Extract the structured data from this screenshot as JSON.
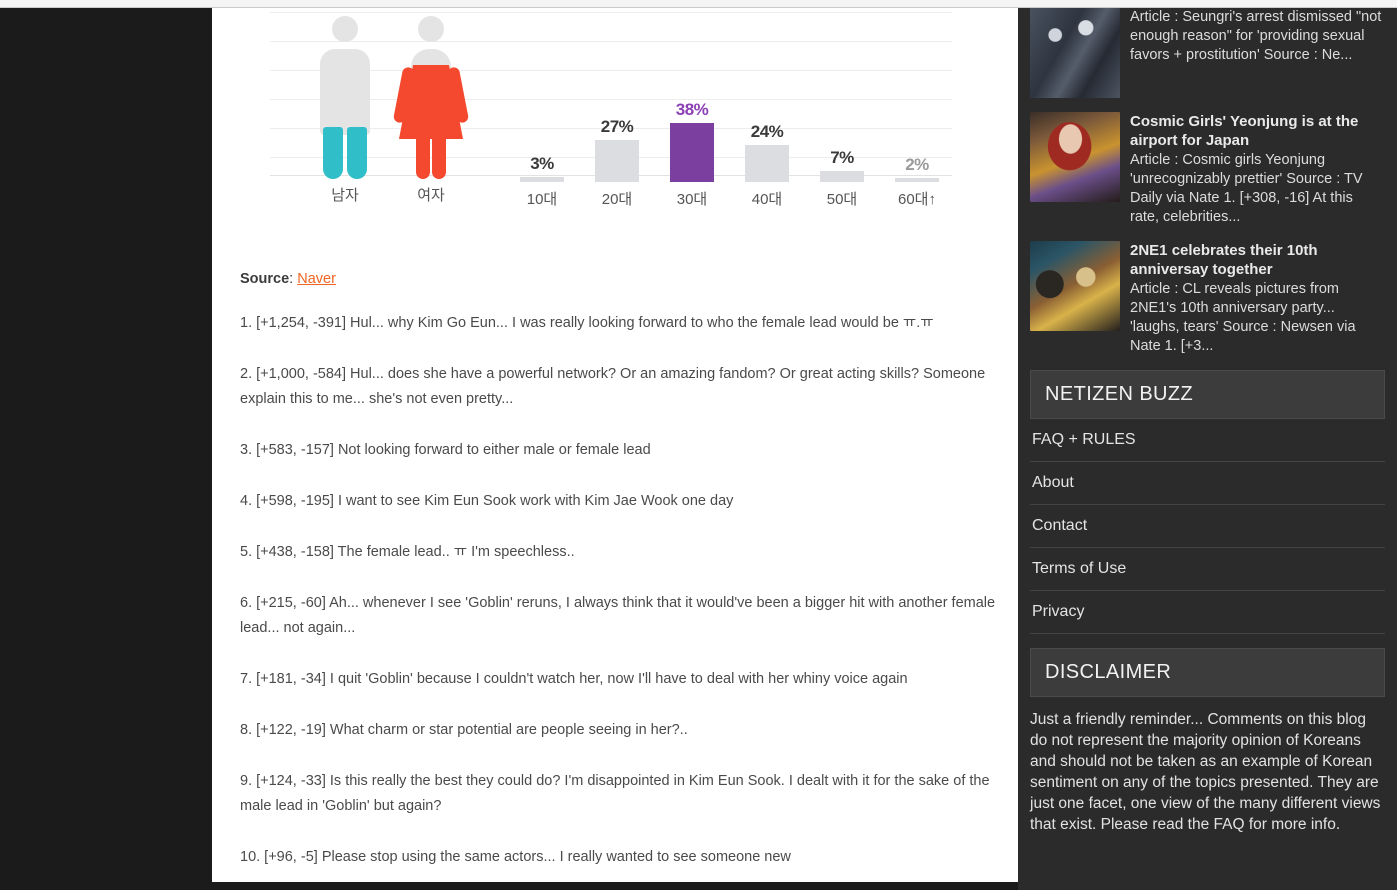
{
  "chart_data": {
    "type": "bar",
    "title": "",
    "xlabel": "",
    "ylabel": "",
    "grid": true,
    "ylim": [
      0,
      45
    ],
    "gender": {
      "categories": [
        "남자",
        "여자"
      ],
      "values": [
        30,
        70
      ],
      "colors": [
        "#30bfc8",
        "#f4492f"
      ],
      "base_color": "#e4e4e4"
    },
    "age": {
      "categories": [
        "10대",
        "20대",
        "30대",
        "40대",
        "50대",
        "60대↑"
      ],
      "values": [
        3,
        27,
        38,
        24,
        7,
        2
      ],
      "labels": [
        "3%",
        "27%",
        "38%",
        "24%",
        "7%",
        "2%"
      ],
      "highlight_index": 2,
      "highlight_color": "#7b3fa0",
      "bar_color": "#dcdde0"
    }
  },
  "post": {
    "source": {
      "label": "Source",
      "separator": ": ",
      "link_text": "Naver"
    },
    "comments": [
      "1. [+1,254, -391] Hul... why Kim Go Eun... I was really looking forward to who the female lead would be ㅠ.ㅠ",
      "2. [+1,000, -584] Hul... does she have a powerful network? Or an amazing fandom? Or great acting skills? Someone explain this to me... she's not even pretty...",
      "3. [+583, -157] Not looking forward to either male or female lead",
      "4. [+598, -195] I want to see Kim Eun Sook work with Kim Jae Wook one day",
      "5. [+438, -158] The female lead.. ㅠ I'm speechless..",
      "6. [+215, -60] Ah... whenever I see 'Goblin' reruns, I always think that it would've been a bigger hit with another female lead... not again...",
      "7. [+181, -34] I quit 'Goblin' because I couldn't watch her, now I'll have to deal with her whiny voice again",
      "8. [+122, -19] What charm or star potential are people seeing in her?..",
      "9. [+124, -33] Is this really the best they could do? I'm disappointed in Kim Eun Sook. I dealt with it for the sake of the male lead in 'Goblin' but again?",
      "10. [+96, -5] Please stop using the same actors... I really wanted to see someone new"
    ]
  },
  "sidebar": {
    "news": [
      {
        "title": "",
        "snippet": "Article : Seungri's arrest dismissed \"not enough reason\" for 'providing sexual favors + prostitution' Source : Ne...",
        "thumb": "suits-photo"
      },
      {
        "title": "Cosmic Girls' Yeonjung is at the airport for Japan",
        "snippet": "Article : Cosmic girls Yeonjung 'unrecognizably prettier' Source : TV Daily via Nate 1. [+308, -16] At this rate, celebrities...",
        "thumb": "redhair-photo"
      },
      {
        "title": "2NE1 celebrates their 10th anniversay together",
        "snippet": "Article : CL reveals pictures from 2NE1's 10th anniversary party... 'laughs, tears' Source : Newsen via Nate 1. [+3...",
        "thumb": "party-photo"
      }
    ],
    "nav_widget": {
      "heading": "NETIZEN BUZZ",
      "items": [
        "FAQ + RULES",
        "About",
        "Contact",
        "Terms of Use",
        "Privacy"
      ]
    },
    "disclaimer_widget": {
      "heading": "DISCLAIMER",
      "body": "Just a friendly reminder... Comments on this blog do not represent the majority opinion of Koreans and should not be taken as an example of Korean sentiment on any of the topics presented. They are just one facet, one view of the many different views that exist. Please read the FAQ for more info."
    }
  }
}
